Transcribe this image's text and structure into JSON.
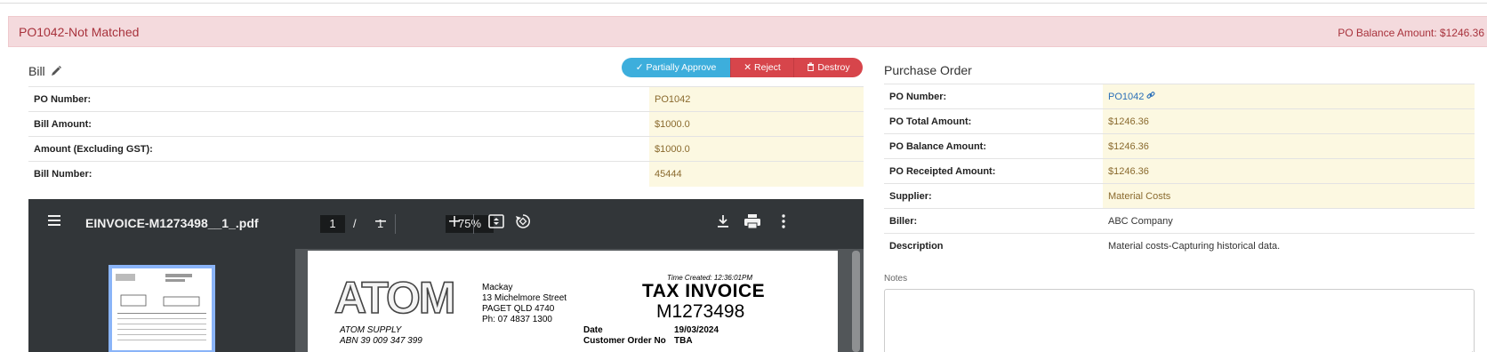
{
  "alert": {
    "title": "PO1042-Not Matched",
    "balance": "PO Balance Amount: $1246.36"
  },
  "bill": {
    "title": "Bill",
    "actions": {
      "approve": "Partially Approve",
      "reject": "Reject",
      "destroy": "Destroy"
    },
    "rows": [
      {
        "label": "PO Number:",
        "value": "PO1042"
      },
      {
        "label": "Bill Amount:",
        "value": "$1000.0"
      },
      {
        "label": "Amount (Excluding GST):",
        "value": "$1000.0"
      },
      {
        "label": "Bill Number:",
        "value": "45444"
      }
    ]
  },
  "pdf_viewer": {
    "filename": "EINVOICE-M1273498__1_.pdf",
    "page_current": "1",
    "page_separator": "/",
    "page_total": "1",
    "zoom": "75%",
    "icons": [
      "menu-icon",
      "zoom-out-icon",
      "zoom-in-icon",
      "fit-page-icon",
      "rotate-icon",
      "download-icon",
      "print-icon",
      "more-icon"
    ],
    "invoice": {
      "logo": "ATOM",
      "branch": "Mackay",
      "address1": "13 Michelmore Street",
      "address2": "PAGET QLD 4740",
      "phone": "Ph:   07 4837 1300",
      "time_created": "Time Created:   12:36:01PM",
      "doc_title": "TAX  INVOICE",
      "doc_number": "M1273498",
      "company": "ATOM SUPPLY",
      "abn": "ABN  39 009 347 399",
      "date_label": "Date",
      "date_value": "19/03/2024",
      "order_label": "Customer Order No",
      "order_value": "TBA"
    }
  },
  "purchase_order": {
    "title": "Purchase Order",
    "rows": [
      {
        "label": "PO Number:",
        "value": "PO1042"
      },
      {
        "label": "PO Total Amount:",
        "value": "$1246.36"
      },
      {
        "label": "PO Balance Amount:",
        "value": "$1246.36"
      },
      {
        "label": "PO Receipted Amount:",
        "value": "$1246.36"
      },
      {
        "label": "Supplier:",
        "value": "Material Costs"
      },
      {
        "label": "Biller:",
        "value": "ABC Company"
      },
      {
        "label": "Description",
        "value": "Material costs-Capturing historical data."
      }
    ]
  },
  "notes": {
    "label": "Notes",
    "value": ""
  },
  "colors": {
    "alert_bg": "#f4dadd",
    "alert_text": "#a8323c",
    "approve": "#3daedc",
    "danger": "#d7454b",
    "highlight": "#fcf8e1",
    "link": "#2a6fb8"
  }
}
